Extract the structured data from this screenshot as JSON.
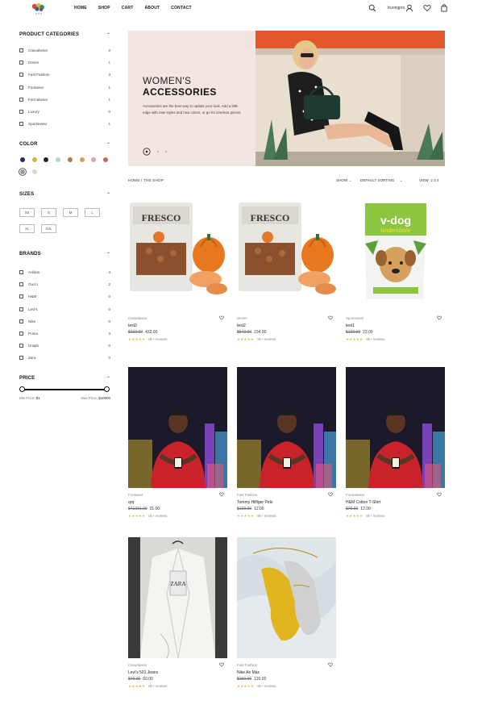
{
  "header": {
    "nav": [
      "HOME",
      "SHOP",
      "CART",
      "ABOUT",
      "CONTACT"
    ],
    "user_name": "truongpro",
    "icons": [
      "search-icon",
      "user-icon",
      "heart-icon",
      "bag-icon"
    ]
  },
  "sidebar": {
    "categories_title": "PRODUCT CATEGORIES",
    "categories": [
      {
        "label": "Casualwear",
        "count": "2"
      },
      {
        "label": "Denim",
        "count": "1"
      },
      {
        "label": "Fast Fashion",
        "count": "3"
      },
      {
        "label": "Footwear",
        "count": "1"
      },
      {
        "label": "Formalwear",
        "count": "1"
      },
      {
        "label": "Luxury",
        "count": "0"
      },
      {
        "label": "Sportswear",
        "count": "1"
      }
    ],
    "color_title": "COLOR",
    "colors": [
      "#1f2f6a",
      "#d6b33a",
      "#222222",
      "#a6d6e6",
      "#b07a3e",
      "#dba04a",
      "#e3a497",
      "#c9645a",
      "#9a9a9a",
      "#c6e3c7"
    ],
    "sizes_title": "SIZES",
    "sizes": [
      "XS",
      "S",
      "M",
      "L",
      "XL",
      "XXL"
    ],
    "brands_title": "BRANDS",
    "brands": [
      {
        "label": "Adidas",
        "count": "4"
      },
      {
        "label": "Gucci",
        "count": "2"
      },
      {
        "label": "H&M",
        "count": "0"
      },
      {
        "label": "Levi's",
        "count": "0"
      },
      {
        "label": "Nike",
        "count": "0"
      },
      {
        "label": "Puma",
        "count": "3"
      },
      {
        "label": "Uniqlo",
        "count": "0"
      },
      {
        "label": "Zara",
        "count": "0"
      }
    ],
    "price_title": "PRICE",
    "min_price_label": "Min Price:",
    "min_price": "$1",
    "max_price_label": "Max Price:",
    "max_price": "$10000"
  },
  "banner": {
    "title_line1": "WOMEN'S",
    "title_line2": "ACCESSORIES",
    "description": "Accessories are the best way to update your look. Add a little edge with new styles and new colors, or go for timeless pieces."
  },
  "toolbar": {
    "breadcrumb": "HOME  /  THE SHOP",
    "show": "SHOW",
    "sorting": "DEFAULT SORTING",
    "view_label": "VIEW",
    "view_options": "2  3  4"
  },
  "products": [
    {
      "category": "Casualwear",
      "name": "test3",
      "old_price": "$132.00",
      "price": "432.00",
      "reviews": "8k+ reviews",
      "image": "fresco-bag"
    },
    {
      "category": "Denim",
      "name": "test2",
      "old_price": "$543.00",
      "price": "234.00",
      "reviews": "8k+ reviews",
      "image": "fresco-bag"
    },
    {
      "category": "Sportswear",
      "name": "test1",
      "old_price": "$132.00",
      "price": "23.00",
      "reviews": "8k+ reviews",
      "image": "vdog-bag"
    },
    {
      "category": "Footwear",
      "name": "qrq",
      "old_price": "$41231.00",
      "price": "21.00",
      "reviews": "8k+ reviews",
      "image": "man-phone"
    },
    {
      "category": "Fast Fashion",
      "name": "Tommy Hilfiger Polo",
      "old_price": "$123.00",
      "price": "12.00",
      "reviews": "8k+ reviews",
      "image": "man-phone"
    },
    {
      "category": "Formalwear",
      "name": "H&M Cotton T-Shirt",
      "old_price": "$70.00",
      "price": "12.00",
      "reviews": "8k+ reviews",
      "image": "man-phone"
    },
    {
      "category": "Casualwear",
      "name": "Levi's 501 Jeans",
      "old_price": "$70.00",
      "price": "60.00",
      "reviews": "8k+ reviews",
      "image": "white-jacket"
    },
    {
      "category": "Fast Fashion",
      "name": "Nike Air Max",
      "old_price": "$150.00",
      "price": "120.00",
      "reviews": "8k+ reviews",
      "image": "yellow-heels"
    }
  ]
}
